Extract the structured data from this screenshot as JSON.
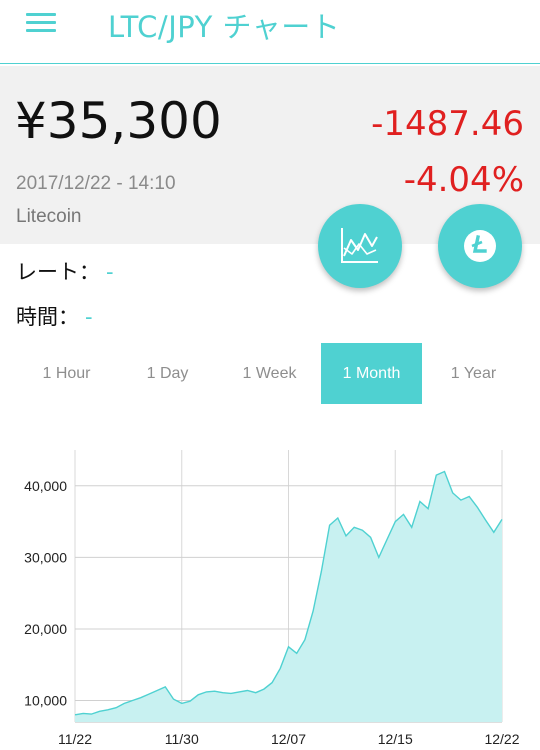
{
  "appbar": {
    "title": "LTC/JPY チャート"
  },
  "quote": {
    "price": "¥35,300",
    "change_abs": "-1487.46",
    "change_pct": "-4.04%",
    "timestamp": "2017/12/22 - 14:10",
    "coin_name": "Litecoin"
  },
  "info": {
    "rate_label": "レート：",
    "rate_value": "-",
    "time_label": "時間：",
    "time_value": "-"
  },
  "tabs": [
    {
      "label": "1 Hour",
      "active": false
    },
    {
      "label": "1 Day",
      "active": false
    },
    {
      "label": "1 Week",
      "active": false
    },
    {
      "label": "1 Month",
      "active": true
    },
    {
      "label": "1 Year",
      "active": false
    }
  ],
  "colors": {
    "accent": "#4fd1d1",
    "fill": "#c8f1f1",
    "negative": "#e02020"
  },
  "icons": {
    "menu": "menu-icon",
    "chart_fab": "line-chart-icon",
    "coin_fab": "litecoin-icon"
  },
  "chart_data": {
    "type": "area",
    "x_ticks": [
      "11/22",
      "11/30",
      "12/07",
      "12/15",
      "12/22"
    ],
    "y_ticks": [
      "10,000",
      "20,000",
      "30,000",
      "40,000"
    ],
    "y_tick_values": [
      10000,
      20000,
      30000,
      40000
    ],
    "ylim": [
      7000,
      45000
    ],
    "grid": true,
    "series": [
      {
        "values": [
          8000,
          8200,
          8100,
          8500,
          8700,
          9000,
          9600,
          10000,
          10400,
          10900,
          11400,
          11900,
          10200,
          9600,
          9900,
          10800,
          11200,
          11300,
          11100,
          11000,
          11200,
          11400,
          11100,
          11600,
          12500,
          14500,
          17500,
          16600,
          18500,
          22500,
          28000,
          34500,
          35500,
          33000,
          34200,
          33800,
          32800,
          30000,
          32500,
          35000,
          36000,
          34200,
          37800,
          36800,
          41500,
          42000,
          39000,
          38000,
          38500,
          37000,
          35200,
          33500,
          35300
        ]
      }
    ]
  }
}
